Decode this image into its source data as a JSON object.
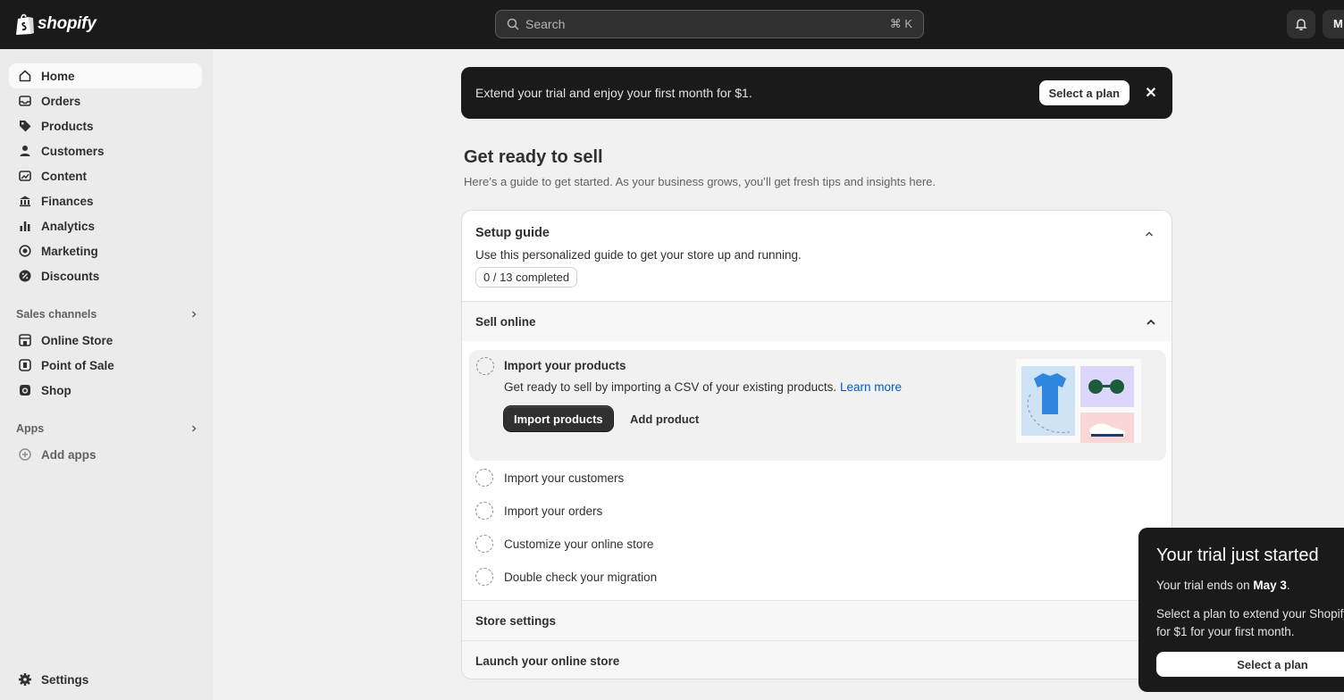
{
  "topbar": {
    "brand": "shopify",
    "search_placeholder": "Search",
    "search_shortcut": "⌘ K",
    "avatar_initial": "M"
  },
  "sidebar": {
    "items": [
      {
        "label": "Home",
        "icon": "home-icon"
      },
      {
        "label": "Orders",
        "icon": "inbox-icon"
      },
      {
        "label": "Products",
        "icon": "tag-icon"
      },
      {
        "label": "Customers",
        "icon": "person-icon"
      },
      {
        "label": "Content",
        "icon": "image-icon"
      },
      {
        "label": "Finances",
        "icon": "bank-icon"
      },
      {
        "label": "Analytics",
        "icon": "bar-chart-icon"
      },
      {
        "label": "Marketing",
        "icon": "target-icon"
      },
      {
        "label": "Discounts",
        "icon": "discount-icon"
      }
    ],
    "sales_channels_title": "Sales channels",
    "channels": [
      {
        "label": "Online Store",
        "icon": "store-icon"
      },
      {
        "label": "Point of Sale",
        "icon": "pos-icon"
      },
      {
        "label": "Shop",
        "icon": "shop-icon"
      }
    ],
    "apps_title": "Apps",
    "add_apps": "Add apps",
    "settings": "Settings"
  },
  "banner": {
    "text": "Extend your trial and enjoy your first month for $1.",
    "button": "Select a plan",
    "close": "✕"
  },
  "page": {
    "title": "Get ready to sell",
    "subtitle": "Here’s a guide to get started. As your business grows, you’ll get fresh tips and insights here."
  },
  "guide": {
    "title": "Setup guide",
    "description": "Use this personalized guide to get your store up and running.",
    "progress": "0 / 13 completed",
    "completed": 0,
    "total": 13,
    "sections": {
      "sell_online": "Sell online",
      "store_settings": "Store settings",
      "launch": "Launch your online store"
    },
    "active_task": {
      "title": "Import your products",
      "description": "Get ready to sell by importing a CSV of your existing products.",
      "link": "Learn more",
      "primary_button": "Import products",
      "secondary_button": "Add product"
    },
    "tasks": [
      "Import your customers",
      "Import your orders",
      "Customize your online store",
      "Double check your migration"
    ]
  },
  "popover": {
    "title": "Your trial just started",
    "ends_prefix": "Your trial ends on ",
    "ends_date": "May 3",
    "ends_suffix": ".",
    "para_line1": "Select a plan to extend your Shopify",
    "para_line2": "for $1 for your first month.",
    "button": "Select a plan"
  },
  "colors": {
    "topbar": "#1a1a1a",
    "sidebar": "#ebebeb",
    "page_bg": "#f1f1f1",
    "link": "#005bd3",
    "primary_button": "#303030"
  }
}
